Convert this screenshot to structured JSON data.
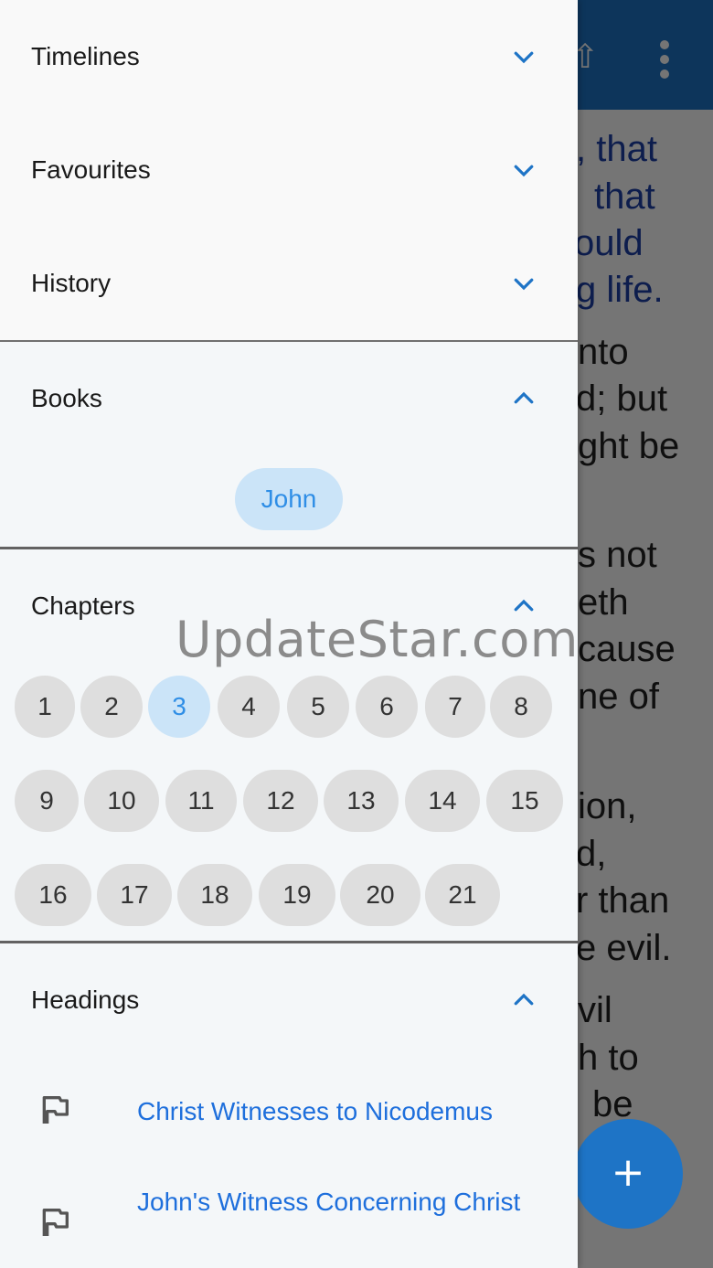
{
  "background": {
    "appbar_color": "#1e74c6",
    "share_icon": "share-icon",
    "more_icon": "more-vertical-icon",
    "text_lines": [
      {
        "text": ", that",
        "blue": true
      },
      {
        "text": "that",
        "blue": true
      },
      {
        "text": "ould",
        "blue": true
      },
      {
        "text": "g life.",
        "blue": true
      },
      {
        "text": "nto",
        "blue": false
      },
      {
        "text": "d; but",
        "blue": false
      },
      {
        "text": "ght be",
        "blue": false
      },
      {
        "text": "",
        "blue": false
      },
      {
        "text": "s not",
        "blue": false
      },
      {
        "text": "eth",
        "blue": false
      },
      {
        "text": "cause",
        "blue": false
      },
      {
        "text": "ne of",
        "blue": false
      },
      {
        "text": "",
        "blue": false
      },
      {
        "text": "ion,",
        "blue": false
      },
      {
        "text": "d,",
        "blue": false
      },
      {
        "text": "r than",
        "blue": false
      },
      {
        "text": "e evil.",
        "blue": false
      },
      {
        "text": "vil",
        "blue": false
      },
      {
        "text": "h to",
        "blue": false
      },
      {
        "text": "be",
        "blue": false
      }
    ],
    "fab_icon": "+"
  },
  "drawer": {
    "sections": {
      "timelines": {
        "label": "Timelines"
      },
      "favourites": {
        "label": "Favourites"
      },
      "history": {
        "label": "History"
      },
      "books": {
        "label": "Books"
      },
      "chapters": {
        "label": "Chapters"
      },
      "headings": {
        "label": "Headings"
      }
    },
    "books": [
      {
        "label": "John",
        "selected": true
      }
    ],
    "chapters": [
      "1",
      "2",
      "3",
      "4",
      "5",
      "6",
      "7",
      "8",
      "9",
      "10",
      "11",
      "12",
      "13",
      "14",
      "15",
      "16",
      "17",
      "18",
      "19",
      "20",
      "21"
    ],
    "selected_chapter": "3",
    "headings": [
      {
        "text": "Christ Witnesses to Nicodemus",
        "icon": "flag-icon"
      },
      {
        "text": "John's Witness Concerning Christ",
        "icon": "flag-icon"
      }
    ]
  },
  "watermark": "UpdateStar.com",
  "colors": {
    "accent": "#1e74c6",
    "chip_selected_bg": "#cbe4f8",
    "chip_selected_text": "#2f8ee6",
    "chip_bg": "#dedede",
    "heading_link": "#1e6fdc"
  }
}
